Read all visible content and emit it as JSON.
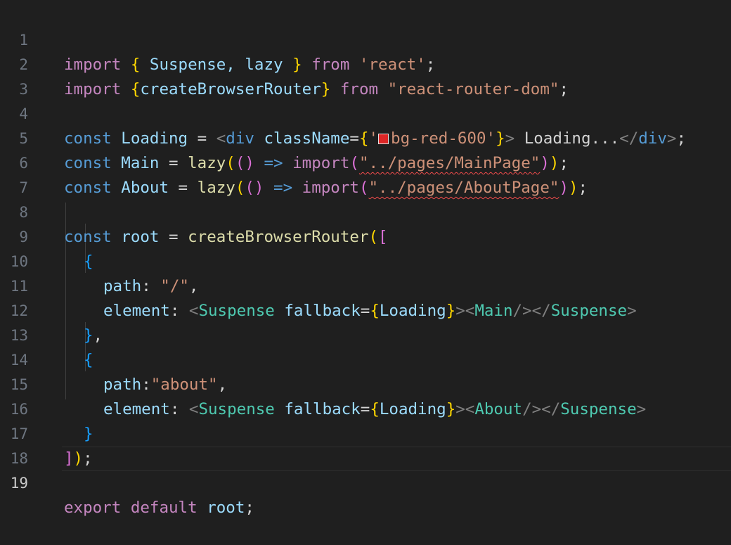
{
  "editor": {
    "active_line": "19",
    "lines": [
      {
        "number": "1",
        "tokens": [
          "import",
          " ",
          "{",
          " Suspense, lazy ",
          "}",
          " ",
          "from",
          " ",
          "'react'",
          ";"
        ]
      },
      {
        "number": "2",
        "tokens": [
          "import",
          " ",
          "{",
          "createBrowserRouter",
          "}",
          " ",
          "from",
          " ",
          "\"react-router-dom\"",
          ";"
        ]
      },
      {
        "number": "3",
        "tokens": []
      },
      {
        "number": "4",
        "tokens": [
          "const",
          " ",
          "Loading",
          " = ",
          "<",
          "div",
          " ",
          "className",
          "=",
          "{",
          "'",
          "bg-red-600'",
          "}",
          ">",
          " Loading...",
          "</",
          "div",
          ">",
          ";"
        ]
      },
      {
        "number": "5",
        "tokens": [
          "const",
          " ",
          "Main",
          " = ",
          "lazy",
          "(",
          "()",
          " => ",
          "import",
          "(",
          "\"../pages/MainPage\"",
          ")",
          ")",
          ";"
        ]
      },
      {
        "number": "6",
        "tokens": [
          "const",
          " ",
          "About",
          " = ",
          "lazy",
          "(",
          "()",
          " => ",
          "import",
          "(",
          "\"../pages/AboutPage\"",
          ")",
          ")",
          ";"
        ]
      },
      {
        "number": "7",
        "tokens": []
      },
      {
        "number": "8",
        "tokens": [
          "const",
          " ",
          "root",
          " = ",
          "createBrowserRouter",
          "(",
          "["
        ]
      },
      {
        "number": "9",
        "tokens": [
          "{"
        ]
      },
      {
        "number": "10",
        "tokens": [
          "path",
          ": ",
          "\"/\"",
          ","
        ]
      },
      {
        "number": "11",
        "tokens": [
          "element",
          ": ",
          "<",
          "Suspense",
          " ",
          "fallback",
          "=",
          "{",
          "Loading",
          "}",
          "><",
          "Main",
          "/></",
          "Suspense",
          ">"
        ]
      },
      {
        "number": "12",
        "tokens": [
          "}",
          ","
        ]
      },
      {
        "number": "13",
        "tokens": [
          "{"
        ]
      },
      {
        "number": "14",
        "tokens": [
          "path",
          ":",
          "\"about\"",
          ","
        ]
      },
      {
        "number": "15",
        "tokens": [
          "element",
          ": ",
          "<",
          "Suspense",
          " ",
          "fallback",
          "=",
          "{",
          "Loading",
          "}",
          "><",
          "About",
          "/></",
          "Suspense",
          ">"
        ]
      },
      {
        "number": "16",
        "tokens": [
          "}"
        ]
      },
      {
        "number": "17",
        "tokens": [
          "]",
          ")",
          ";"
        ]
      },
      {
        "number": "18",
        "tokens": []
      },
      {
        "number": "19",
        "tokens": [
          "export",
          " ",
          "default",
          " ",
          "root",
          ";"
        ]
      }
    ],
    "color_decorator": {
      "line": "4",
      "color": "#dc2626"
    },
    "error_squiggles": [
      "\"../pages/MainPage\"",
      "\"../pages/AboutPage\""
    ]
  },
  "theme": {
    "background": "#1f1f1f",
    "keyword_control": "#c586c0",
    "keyword": "#569cd6",
    "variable": "#9cdcfe",
    "function": "#dcdcaa",
    "string": "#ce9178",
    "component": "#4ec9b0",
    "bracket_level1": "#ffd700",
    "bracket_level2": "#da70d6",
    "bracket_level3": "#179fff",
    "error": "#f14c4c"
  }
}
